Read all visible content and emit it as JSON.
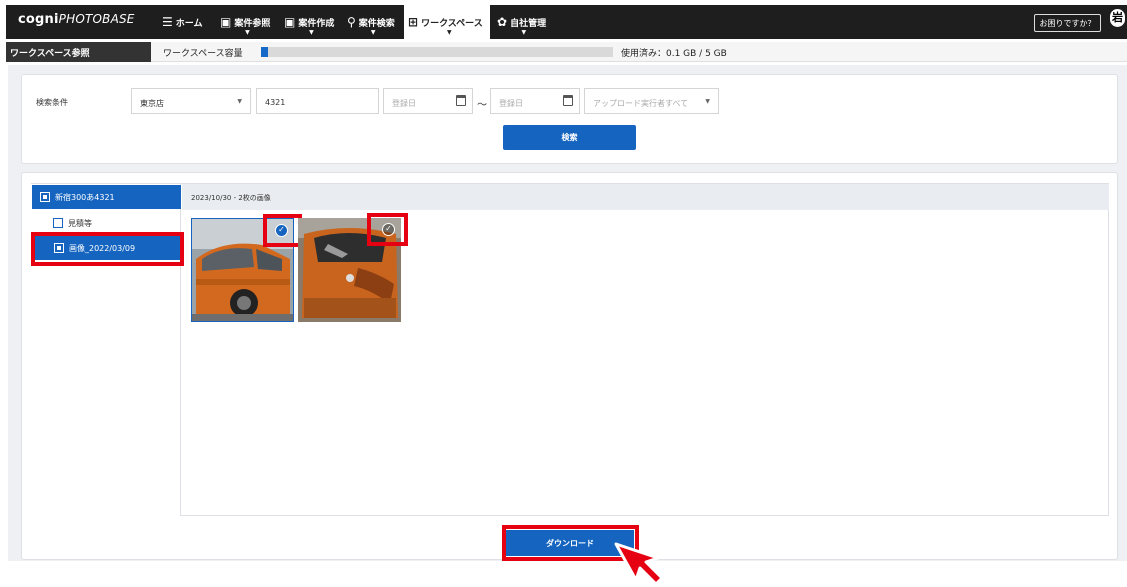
{
  "app": {
    "logo_prefix": "cogni",
    "logo_suffix": "PHOTOBASE"
  },
  "nav": [
    {
      "icon": "list-icon",
      "label": "ホーム"
    },
    {
      "icon": "image-icon",
      "label": "案件参照"
    },
    {
      "icon": "image-add-icon",
      "label": "案件作成"
    },
    {
      "icon": "search-icon",
      "label": "案件検索"
    },
    {
      "icon": "workspace-icon",
      "label": "ワークスペース"
    },
    {
      "icon": "gear-icon",
      "label": "自社管理"
    }
  ],
  "header": {
    "help_label": "お困りですか？",
    "avatar_text": "岩"
  },
  "subbar": {
    "page_title": "ワークスペース参照",
    "capacity_label": "ワークスペース容量",
    "capacity_used_fraction": 0.02,
    "usage_text": "使用済み：0.1 GB / 5 GB"
  },
  "search": {
    "label": "検索条件",
    "store_value": "東京店",
    "keyword_value": "4321",
    "date_from_placeholder": "登録日",
    "range_sep": "～",
    "date_to_placeholder": "登録日",
    "uploader_placeholder": "アップロード実行者すべて",
    "button_label": "検索"
  },
  "tree": {
    "root_label": "新宿300あ4321",
    "children": [
      {
        "label": "見積等"
      },
      {
        "label": "画像_2022/03/09"
      }
    ]
  },
  "gallery": {
    "header": "2023/10/30 - 2枚の画像",
    "check_glyph": "✓"
  },
  "actions": {
    "download_label": "ダウンロード"
  },
  "colors": {
    "accent": "#1565c0",
    "highlight": "#e50012",
    "topbar": "#1e1e1e"
  }
}
